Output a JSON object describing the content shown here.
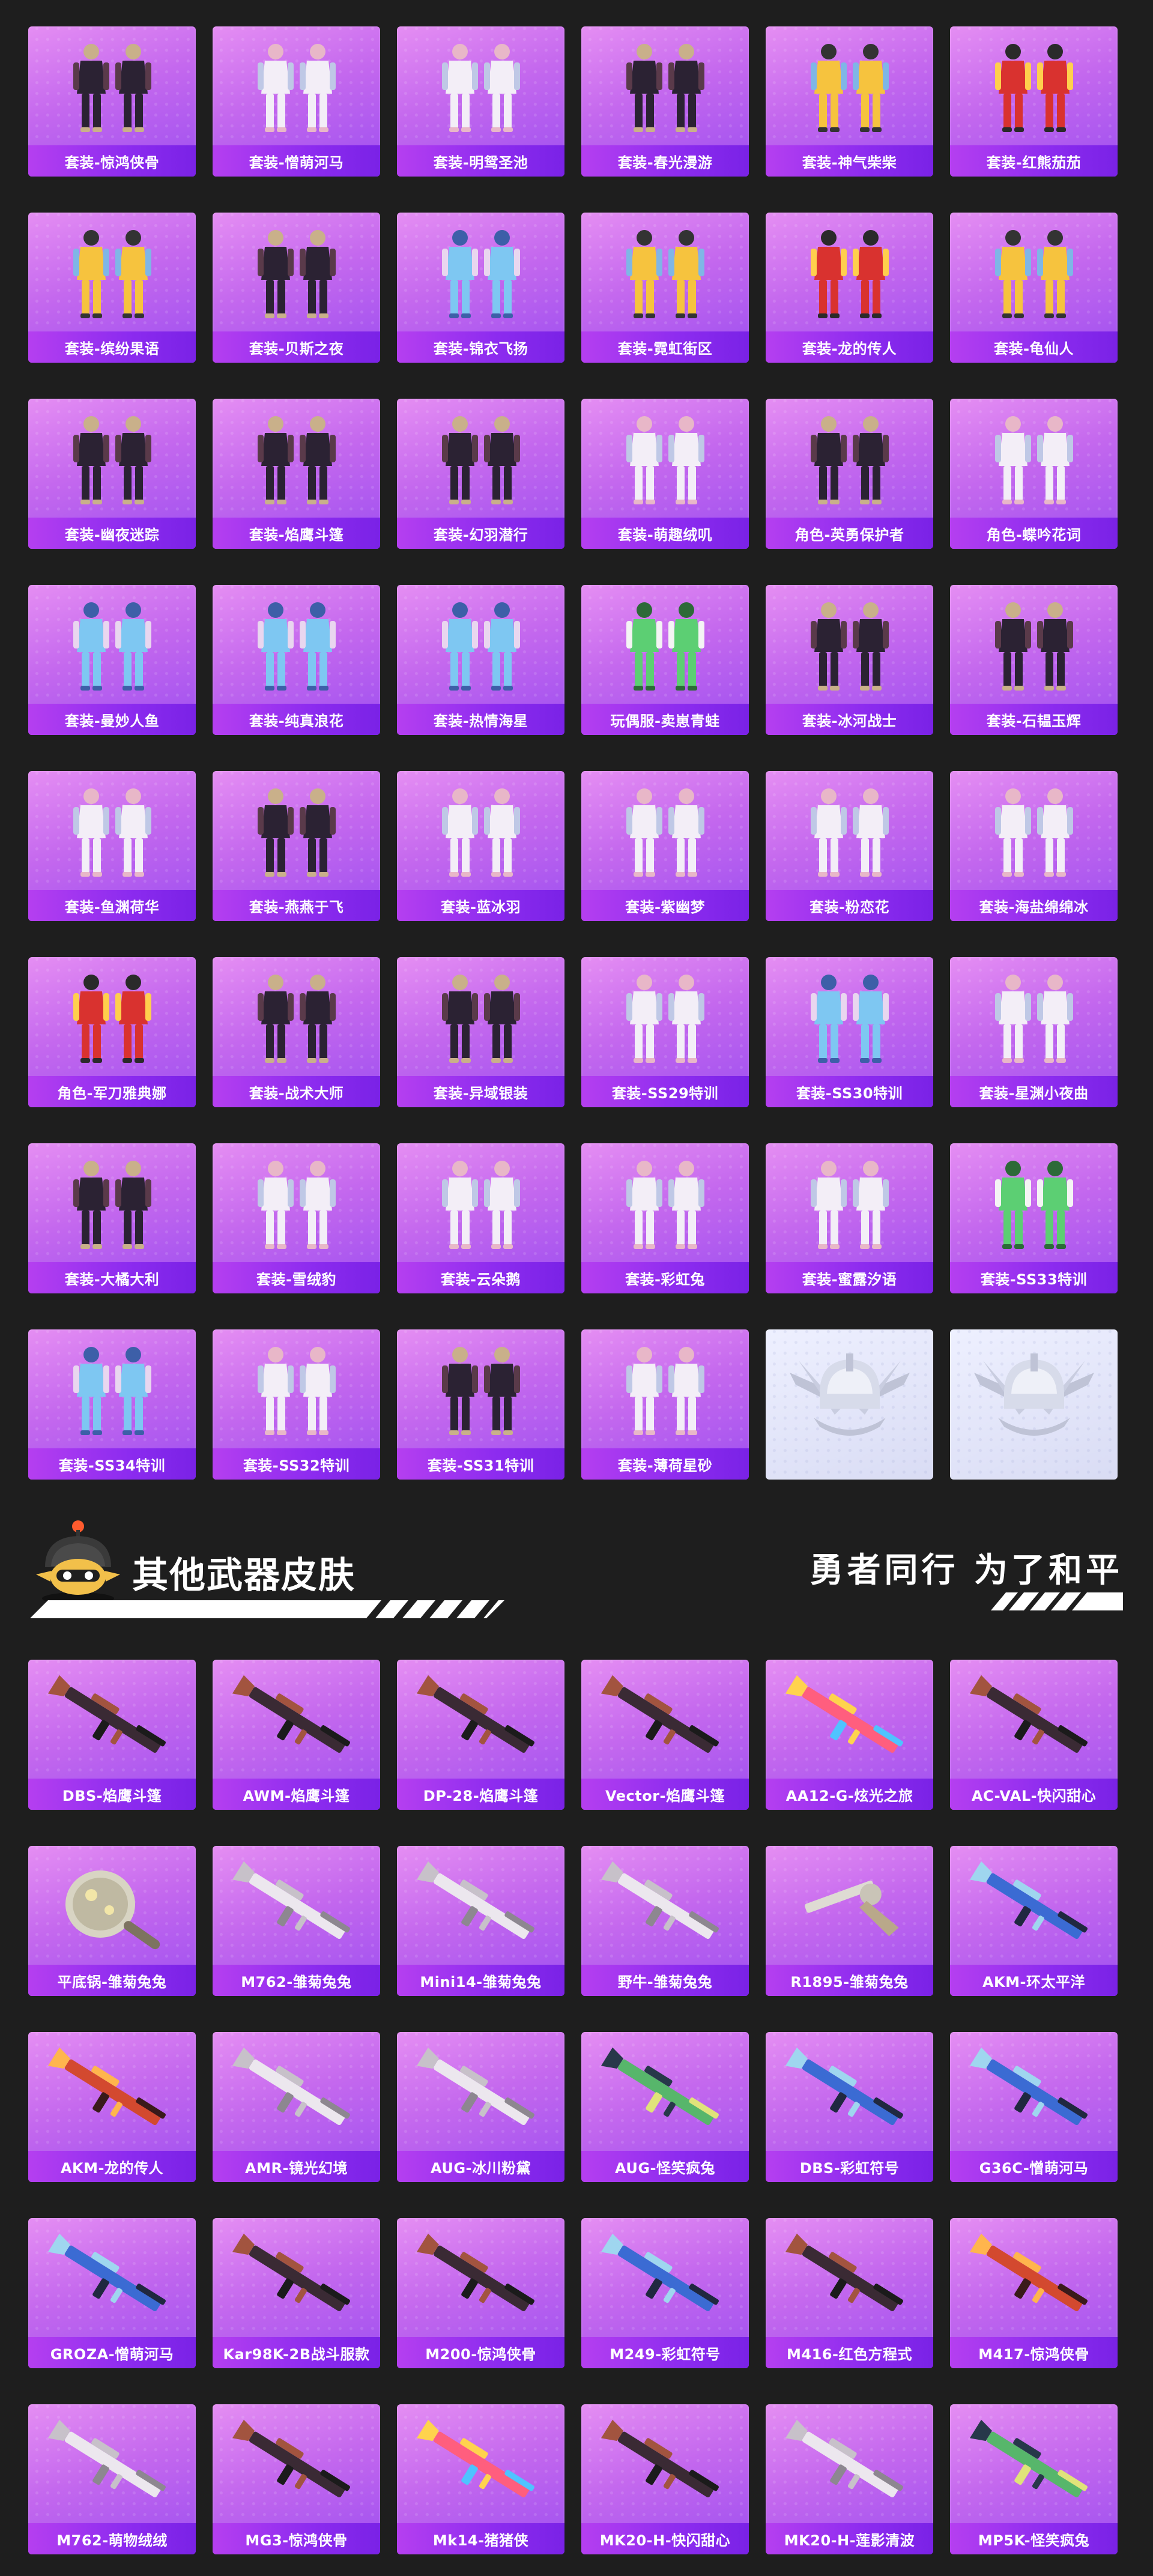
{
  "outfits": [
    {
      "label": "套装-惊鸿侠骨",
      "kind": "outfit-dark"
    },
    {
      "label": "套装-憎萌河马",
      "kind": "outfit-light"
    },
    {
      "label": "套装-明鸳圣池",
      "kind": "outfit-light"
    },
    {
      "label": "套装-春光漫游",
      "kind": "outfit-dark"
    },
    {
      "label": "套装-神气柴柴",
      "kind": "outfit-yellow"
    },
    {
      "label": "套装-红熊茄茄",
      "kind": "outfit-red"
    },
    {
      "label": "套装-缤纷果语",
      "kind": "outfit-yellow"
    },
    {
      "label": "套装-贝斯之夜",
      "kind": "outfit-dark"
    },
    {
      "label": "套装-锦衣飞扬",
      "kind": "outfit-blue"
    },
    {
      "label": "套装-霓虹街区",
      "kind": "outfit-yellow"
    },
    {
      "label": "套装-龙的传人",
      "kind": "outfit-red"
    },
    {
      "label": "套装-龟仙人",
      "kind": "outfit-yellow"
    },
    {
      "label": "套装-幽夜迷踪",
      "kind": "outfit-dark"
    },
    {
      "label": "套装-焰鹰斗篷",
      "kind": "outfit-dark"
    },
    {
      "label": "套装-幻羽潜行",
      "kind": "outfit-dark"
    },
    {
      "label": "套装-萌趣绒叽",
      "kind": "outfit-light"
    },
    {
      "label": "角色-英勇保护者",
      "kind": "outfit-dark"
    },
    {
      "label": "角色-蝶吟花词",
      "kind": "outfit-light"
    },
    {
      "label": "套装-曼妙人鱼",
      "kind": "outfit-blue"
    },
    {
      "label": "套装-纯真浪花",
      "kind": "outfit-blue"
    },
    {
      "label": "套装-热情海星",
      "kind": "outfit-blue"
    },
    {
      "label": "玩偶服-卖崽青蛙",
      "kind": "outfit-green"
    },
    {
      "label": "套装-冰河战士",
      "kind": "outfit-dark"
    },
    {
      "label": "套装-石韫玉辉",
      "kind": "outfit-dark"
    },
    {
      "label": "套装-鱼渊荷华",
      "kind": "outfit-light"
    },
    {
      "label": "套装-燕燕于飞",
      "kind": "outfit-dark"
    },
    {
      "label": "套装-蓝冰羽",
      "kind": "outfit-light"
    },
    {
      "label": "套装-紫幽梦",
      "kind": "outfit-light"
    },
    {
      "label": "套装-粉恋花",
      "kind": "outfit-light"
    },
    {
      "label": "套装-海盐绵绵冰",
      "kind": "outfit-light"
    },
    {
      "label": "角色-军刀雅典娜",
      "kind": "outfit-red"
    },
    {
      "label": "套装-战术大师",
      "kind": "outfit-dark"
    },
    {
      "label": "套装-异域银装",
      "kind": "outfit-dark"
    },
    {
      "label": "套装-SS29特训",
      "kind": "outfit-light"
    },
    {
      "label": "套装-SS30特训",
      "kind": "outfit-blue"
    },
    {
      "label": "套装-星渊小夜曲",
      "kind": "outfit-light"
    },
    {
      "label": "套装-大橘大利",
      "kind": "outfit-dark"
    },
    {
      "label": "套装-雪绒豹",
      "kind": "outfit-light"
    },
    {
      "label": "套装-云朵鹅",
      "kind": "outfit-light"
    },
    {
      "label": "套装-彩虹兔",
      "kind": "outfit-light"
    },
    {
      "label": "套装-蜜露汐语",
      "kind": "outfit-light"
    },
    {
      "label": "套装-SS33特训",
      "kind": "outfit-green"
    },
    {
      "label": "套装-SS34特训",
      "kind": "outfit-blue"
    },
    {
      "label": "套装-SS32特训",
      "kind": "outfit-light"
    },
    {
      "label": "套装-SS31特训",
      "kind": "outfit-dark"
    },
    {
      "label": "套装-薄荷星砂",
      "kind": "outfit-light"
    },
    {
      "label": "",
      "kind": "emblem"
    },
    {
      "label": "",
      "kind": "emblem"
    }
  ],
  "section": {
    "title": "其他武器皮肤",
    "slogan": "勇者同行 为了和平"
  },
  "weapons": [
    {
      "label": "DBS-焰鹰斗篷",
      "kind": "gun-dark"
    },
    {
      "label": "AWM-焰鹰斗篷",
      "kind": "gun-dark"
    },
    {
      "label": "DP-28-焰鹰斗篷",
      "kind": "gun-dark"
    },
    {
      "label": "Vector-焰鹰斗篷",
      "kind": "gun-dark"
    },
    {
      "label": "AA12-G-炫光之旅",
      "kind": "gun-rainbow"
    },
    {
      "label": "AC-VAL-快闪甜心",
      "kind": "gun-dark"
    },
    {
      "label": "平底锅-雏菊兔兔",
      "kind": "pan"
    },
    {
      "label": "M762-雏菊兔兔",
      "kind": "gun-light"
    },
    {
      "label": "Mini14-雏菊兔兔",
      "kind": "gun-light"
    },
    {
      "label": "野牛-雏菊兔兔",
      "kind": "gun-light"
    },
    {
      "label": "R1895-雏菊兔兔",
      "kind": "pistol"
    },
    {
      "label": "AKM-环太平洋",
      "kind": "gun-blue"
    },
    {
      "label": "AKM-龙的传人",
      "kind": "gun-red"
    },
    {
      "label": "AMR-镜光幻境",
      "kind": "gun-light"
    },
    {
      "label": "AUG-冰川粉黛",
      "kind": "gun-light"
    },
    {
      "label": "AUG-怪笑疯兔",
      "kind": "gun-green"
    },
    {
      "label": "DBS-彩虹符号",
      "kind": "gun-blue"
    },
    {
      "label": "G36C-憎萌河马",
      "kind": "gun-blue"
    },
    {
      "label": "GROZA-憎萌河马",
      "kind": "gun-blue"
    },
    {
      "label": "Kar98K-2B战斗服款",
      "kind": "gun-dark"
    },
    {
      "label": "M200-惊鸿侠骨",
      "kind": "gun-dark"
    },
    {
      "label": "M249-彩虹符号",
      "kind": "gun-blue"
    },
    {
      "label": "M416-红色方程式",
      "kind": "gun-dark"
    },
    {
      "label": "M417-惊鸿侠骨",
      "kind": "gun-red"
    },
    {
      "label": "M762-萌物绒绒",
      "kind": "gun-light"
    },
    {
      "label": "MG3-惊鸿侠骨",
      "kind": "gun-dark"
    },
    {
      "label": "Mk14-猪猪侠",
      "kind": "gun-rainbow"
    },
    {
      "label": "MK20-H-快闪甜心",
      "kind": "gun-dark"
    },
    {
      "label": "MK20-H-莲影清波",
      "kind": "gun-light"
    },
    {
      "label": "MP5K-怪笑疯兔",
      "kind": "gun-green"
    }
  ]
}
